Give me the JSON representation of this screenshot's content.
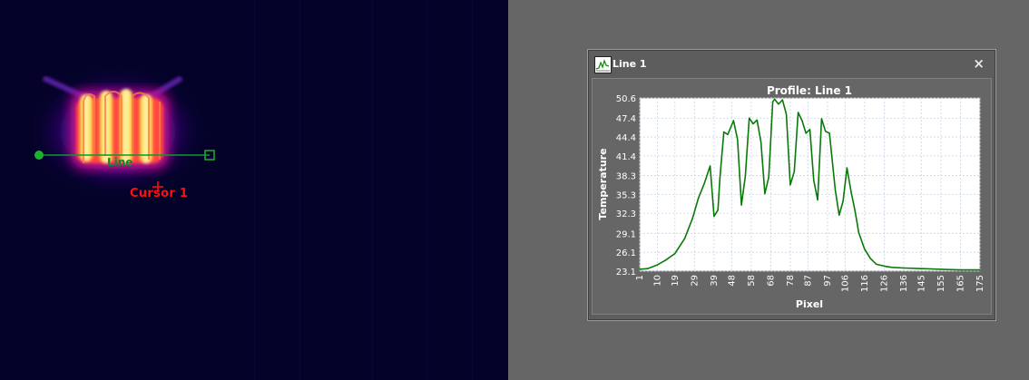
{
  "thermal_view": {
    "line_label": "Line",
    "cursor_label": "Cursor 1"
  },
  "profile_window": {
    "title": "Line 1",
    "close_label": "×",
    "icon": "chart-icon"
  },
  "colors": {
    "line_series": "#087a08",
    "overlay_line": "#0a9a2a",
    "cursor": "#ff1010",
    "plot_background": "#ffffff",
    "window_background": "#666666"
  },
  "chart_data": {
    "type": "line",
    "title": "Profile: Line 1",
    "xlabel": "Pixel",
    "ylabel": "Temperature",
    "xlim": [
      1,
      175
    ],
    "ylim": [
      23.1,
      50.6
    ],
    "grid": true,
    "x_ticks": [
      "1",
      "10",
      "19",
      "29",
      "39",
      "48",
      "58",
      "68",
      "78",
      "87",
      "97",
      "106",
      "116",
      "126",
      "136",
      "145",
      "155",
      "165",
      "175"
    ],
    "y_ticks": [
      "23.1",
      "26.1",
      "29.1",
      "32.3",
      "35.3",
      "38.3",
      "41.4",
      "44.4",
      "47.4",
      "50.6"
    ],
    "series": [
      {
        "x": [
          1,
          5,
          10,
          14,
          19,
          24,
          28,
          31,
          34,
          37,
          39,
          41,
          42,
          44,
          46,
          49,
          51,
          53,
          55,
          57,
          59,
          61,
          63,
          65,
          67,
          69,
          70,
          72,
          74,
          76,
          78,
          80,
          82,
          84,
          86,
          88,
          90,
          92,
          94,
          96,
          98,
          101,
          103,
          105,
          107,
          109,
          111,
          113,
          116,
          119,
          122,
          126,
          130,
          136,
          145,
          155,
          165,
          175
        ],
        "values": [
          23.4,
          23.5,
          24.1,
          24.8,
          25.9,
          28.3,
          31.5,
          34.7,
          37.0,
          39.8,
          31.8,
          32.8,
          37.9,
          45.2,
          44.8,
          47.0,
          44.0,
          33.6,
          38.2,
          47.4,
          46.5,
          47.1,
          43.6,
          35.4,
          38.0,
          50.0,
          50.4,
          49.6,
          50.3,
          48.0,
          36.8,
          38.9,
          48.3,
          47.0,
          45.0,
          45.6,
          37.5,
          34.4,
          47.3,
          45.3,
          45.0,
          36.0,
          32.0,
          34.2,
          39.5,
          35.8,
          32.8,
          29.2,
          26.6,
          25.1,
          24.2,
          23.9,
          23.7,
          23.6,
          23.5,
          23.4,
          23.3,
          23.3
        ]
      }
    ]
  }
}
